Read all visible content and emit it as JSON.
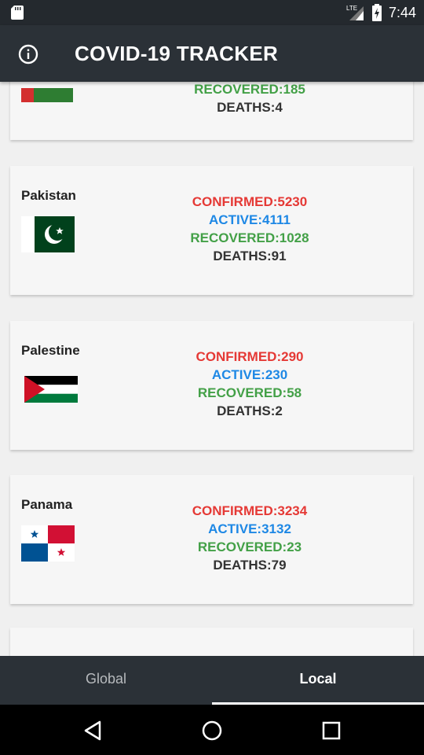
{
  "status_bar": {
    "network_label": "LTE",
    "time": "7:44"
  },
  "app_bar": {
    "title": "COVID-19 TRACKER",
    "info_icon": "info-icon"
  },
  "countries": [
    {
      "name": "",
      "confirmed": "",
      "active": "",
      "recovered": "RECOVERED:185",
      "deaths": "DEATHS:4"
    },
    {
      "name": "Pakistan",
      "confirmed": "CONFIRMED:5230",
      "active": "ACTIVE:4111",
      "recovered": "RECOVERED:1028",
      "deaths": "DEATHS:91"
    },
    {
      "name": "Palestine",
      "confirmed": "CONFIRMED:290",
      "active": "ACTIVE:230",
      "recovered": "RECOVERED:58",
      "deaths": "DEATHS:2"
    },
    {
      "name": "Panama",
      "confirmed": "CONFIRMED:3234",
      "active": "ACTIVE:3132",
      "recovered": "RECOVERED:23",
      "deaths": "DEATHS:79"
    }
  ],
  "colors": {
    "confirmed": "#e53935",
    "active": "#1e88e5",
    "recovered": "#43a047",
    "deaths": "#333333",
    "app_bar": "#2b3137"
  },
  "bottom_nav": {
    "tabs": [
      {
        "label": "Global"
      },
      {
        "label": "Local"
      }
    ],
    "selected": "Local"
  },
  "system_nav": {
    "icons": [
      "back-icon",
      "home-icon",
      "recents-icon"
    ]
  }
}
